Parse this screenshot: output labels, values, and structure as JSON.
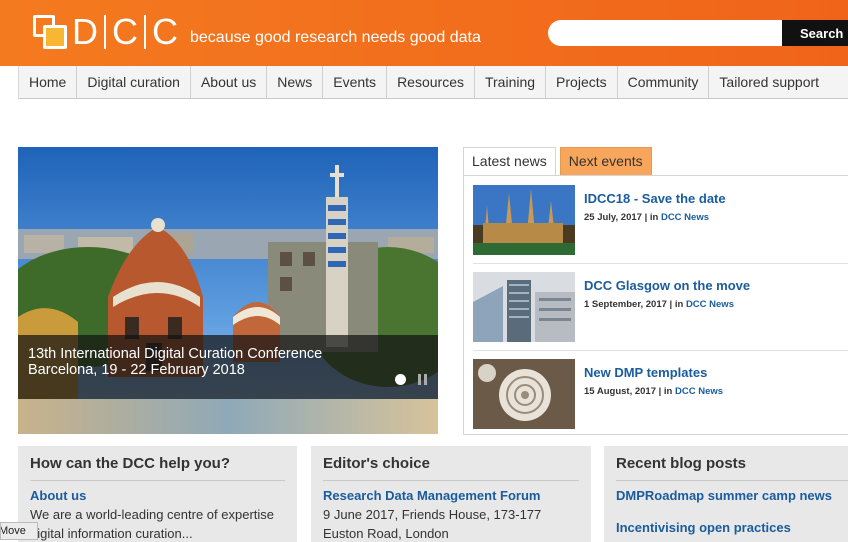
{
  "header": {
    "logo_letters": [
      "D",
      "C",
      "C"
    ],
    "tagline": "because good research needs good data",
    "search_placeholder": "",
    "search_button": "Search"
  },
  "nav": {
    "items": [
      "Home",
      "Digital curation",
      "About us",
      "News",
      "Events",
      "Resources",
      "Training",
      "Projects",
      "Community",
      "Tailored support"
    ]
  },
  "carousel": {
    "caption_line1": "13th International Digital Curation Conference",
    "caption_line2": "Barcelona, 19 - 22 February 2018"
  },
  "news": {
    "tabs": [
      "Latest news",
      "Next events"
    ],
    "items": [
      {
        "title": "IDCC18 - Save the date",
        "date": "25 July, 2017 | in ",
        "category": "DCC News"
      },
      {
        "title": "DCC Glasgow on the move",
        "date": "1 September, 2017 | in ",
        "category": "DCC News"
      },
      {
        "title": "New DMP templates",
        "date": "15 August, 2017 | in ",
        "category": "DCC News"
      }
    ]
  },
  "boxes": {
    "help": {
      "title": "How can the DCC help you?",
      "link": "About us",
      "text1": "We are a world-leading centre of expertise",
      "text2": "digital information curation..."
    },
    "editor": {
      "title": "Editor's choice",
      "link": "Research Data Management Forum",
      "text1": "9 June 2017, Friends House, 173-177",
      "text2": "Euston Road, London"
    },
    "blog": {
      "title": "Recent blog posts",
      "link1": "DMPRoadmap summer camp news",
      "link2": "Incentivising open practices"
    }
  },
  "move_button": "Move",
  "colors": {
    "header_orange": "#f47a1f",
    "tab_orange": "#f7a65b",
    "link_blue": "#1a5c9e"
  }
}
